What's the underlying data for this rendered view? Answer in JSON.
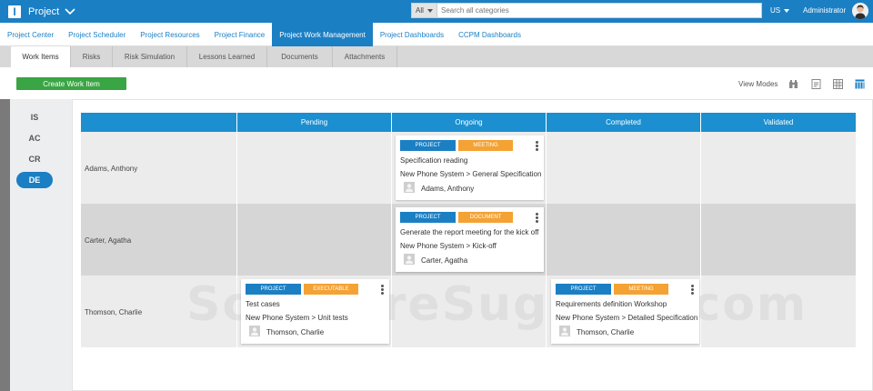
{
  "app": {
    "logo": "I",
    "title": "Project"
  },
  "search": {
    "category": "All",
    "placeholder": "Search all categories"
  },
  "header": {
    "language": "US",
    "user": "Administrator"
  },
  "nav": [
    "Project Center",
    "Project Scheduler",
    "Project Resources",
    "Project Finance",
    "Project Work Management",
    "Project Dashboards",
    "CCPM Dashboards"
  ],
  "nav_active": "Project Work Management",
  "tabs": [
    "Work Items",
    "Risks",
    "Risk Simulation",
    "Lessons Learned",
    "Documents",
    "Attachments"
  ],
  "tab_active": "Work Items",
  "toolbar": {
    "create_label": "Create Work Item",
    "view_modes_label": "View Modes"
  },
  "lanes": [
    "IS",
    "AC",
    "CR",
    "DE"
  ],
  "lane_active": "DE",
  "columns": [
    "Pending",
    "Ongoing",
    "Completed",
    "Validated"
  ],
  "rows": [
    {
      "name": "Adams, Anthony"
    },
    {
      "name": "Carter, Agatha"
    },
    {
      "name": "Thomson, Charlie"
    }
  ],
  "cards": [
    {
      "tags": [
        "PROJECT",
        "MEETING"
      ],
      "title": "Specification reading",
      "path": "New Phone System > General Specification",
      "user": "Adams, Anthony"
    },
    {
      "tags": [
        "PROJECT",
        "DOCUMENT"
      ],
      "title": "Generate the report meeting for the kick off",
      "path": "New Phone System > Kick-off",
      "user": "Carter, Agatha"
    },
    {
      "tags": [
        "PROJECT",
        "EXECUTABLE"
      ],
      "title": "Test cases",
      "path": "New Phone System > Unit tests",
      "user": "Thomson, Charlie"
    },
    {
      "tags": [
        "PROJECT",
        "MEETING"
      ],
      "title": "Requirements definition Workshop",
      "path": "New Phone System > Detailed Specification",
      "user": "Thomson, Charlie"
    }
  ],
  "watermark": "SoftwareSuggest.com",
  "colors": {
    "primary": "#1b7fc4",
    "header_col": "#1b8fd0",
    "green": "#3aa544",
    "orange": "#f4a233"
  }
}
